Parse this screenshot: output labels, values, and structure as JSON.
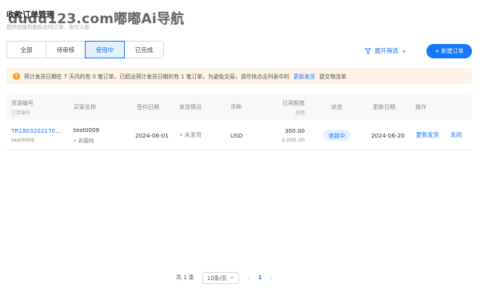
{
  "page": {
    "title": "收款订单管理",
    "subtitle": "提供创建和跟踪合同订单、收付入账",
    "watermark": "dudu123.com嘟嘟Ai导航"
  },
  "tabs": [
    {
      "label": "全部",
      "active": false
    },
    {
      "label": "待审核",
      "active": false
    },
    {
      "label": "使用中",
      "active": true
    },
    {
      "label": "已完成",
      "active": false
    }
  ],
  "toolbar": {
    "filter_label": "展开筛选",
    "new_order_label": "+ 新建订单"
  },
  "alert": {
    "text": "预计发货日期在 7 天内的有 0 笔订单，已超出预计发货日期的有 1 笔订单，为避免交易，请尽快点击列表中的",
    "link": "更新发货",
    "suffix": "提交物流单"
  },
  "table": {
    "headers": {
      "resource": "资源编号",
      "resource_sub": "订单编号",
      "buyer": "买家名称",
      "sign_date": "签约日期",
      "shipping": "发货情况",
      "currency": "币种",
      "used_amount": "已用额度",
      "used_amount_sub": "总额",
      "status": "状态",
      "update_date": "更新日期",
      "actions": "操作"
    },
    "rows": [
      {
        "resource_id": "TR1803202170...",
        "order_id": "test0009",
        "buyer": "test0009",
        "buyer_sub": "• 新疆网",
        "sign_date": "2024-06-01",
        "shipping": "• 未发货",
        "currency": "USD",
        "used": "300.00",
        "total": "2,000.00",
        "status": "收款中",
        "update_date": "2024-06-20",
        "action_update": "更新发货",
        "action_close": "关闭"
      }
    ]
  },
  "pagination": {
    "total": "共 1 条",
    "page_size": "10条/页",
    "prev": "‹",
    "current": "1",
    "next": "›"
  }
}
